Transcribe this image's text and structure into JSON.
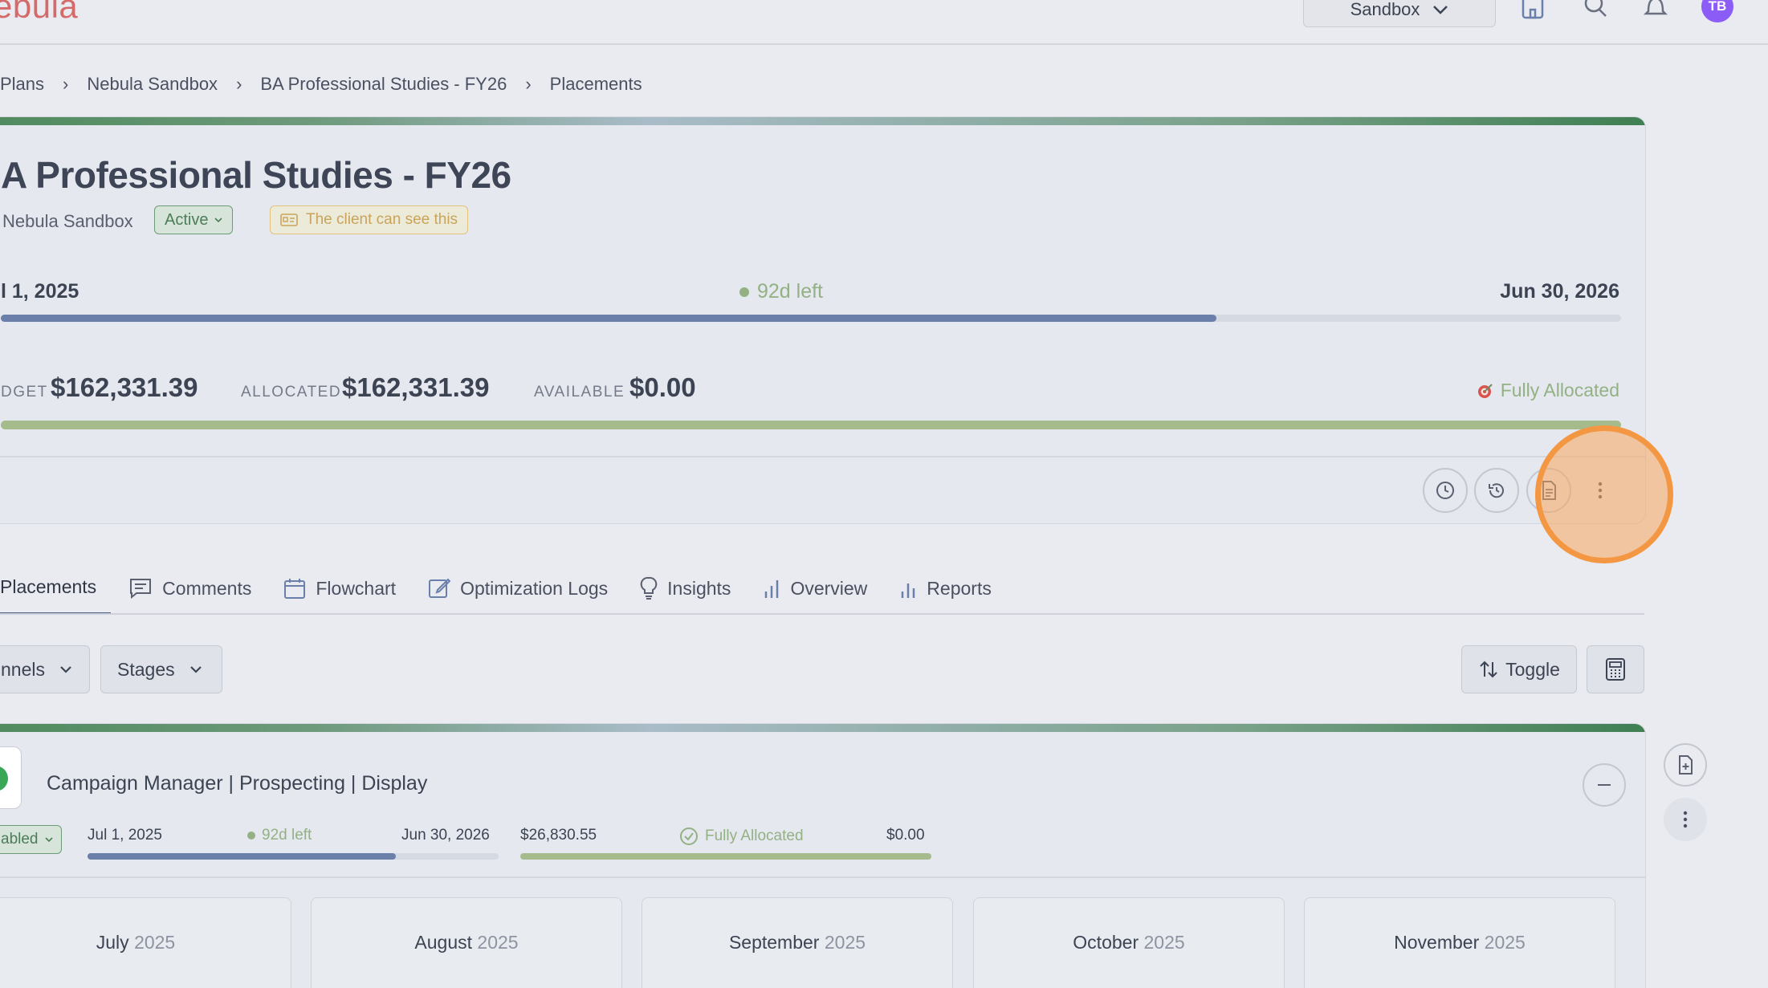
{
  "app": {
    "logo": "ebula"
  },
  "topbar": {
    "workspace_select": "Sandbox",
    "avatar_initials": "TB"
  },
  "breadcrumb": {
    "items": [
      "Plans",
      "Nebula Sandbox",
      "BA Professional Studies - FY26",
      "Placements"
    ]
  },
  "plan": {
    "title": "A Professional Studies - FY26",
    "org": "Nebula Sandbox",
    "status": "Active",
    "client_visibility": "The client can see this",
    "start_date": "l 1, 2025",
    "days_left": "92d left",
    "end_date": "Jun 30, 2026",
    "time_progress": 0.75,
    "budget_label": "DGET",
    "budget_value": "$162,331.39",
    "allocated_label": "ALLOCATED",
    "allocated_value": "$162,331.39",
    "available_label": "AVAILABLE",
    "available_value": "$0.00",
    "allocation_status": "Fully Allocated",
    "allocation_progress": 1.0
  },
  "tabs": [
    {
      "label": "Placements",
      "icon": "list-icon",
      "active": true
    },
    {
      "label": "Comments",
      "icon": "comment-icon"
    },
    {
      "label": "Flowchart",
      "icon": "calendar-icon"
    },
    {
      "label": "Optimization Logs",
      "icon": "edit-icon"
    },
    {
      "label": "Insights",
      "icon": "lightbulb-icon"
    },
    {
      "label": "Overview",
      "icon": "bar-chart-icon"
    },
    {
      "label": "Reports",
      "icon": "bar-chart-icon"
    }
  ],
  "filters": {
    "channels": "nnels",
    "stages": "Stages",
    "toggle": "Toggle"
  },
  "placement": {
    "title": "Campaign Manager | Prospecting | Display",
    "status": "abled",
    "start_date": "Jul 1, 2025",
    "days_left": "92d left",
    "end_date": "Jun 30, 2026",
    "time_progress": 0.75,
    "budget": "$26,830.55",
    "allocation_status": "Fully Allocated",
    "available": "$0.00",
    "months": [
      {
        "name": "July",
        "year": "2025"
      },
      {
        "name": "August",
        "year": "2025"
      },
      {
        "name": "September",
        "year": "2025"
      },
      {
        "name": "October",
        "year": "2025"
      },
      {
        "name": "November",
        "year": "2025"
      }
    ]
  }
}
